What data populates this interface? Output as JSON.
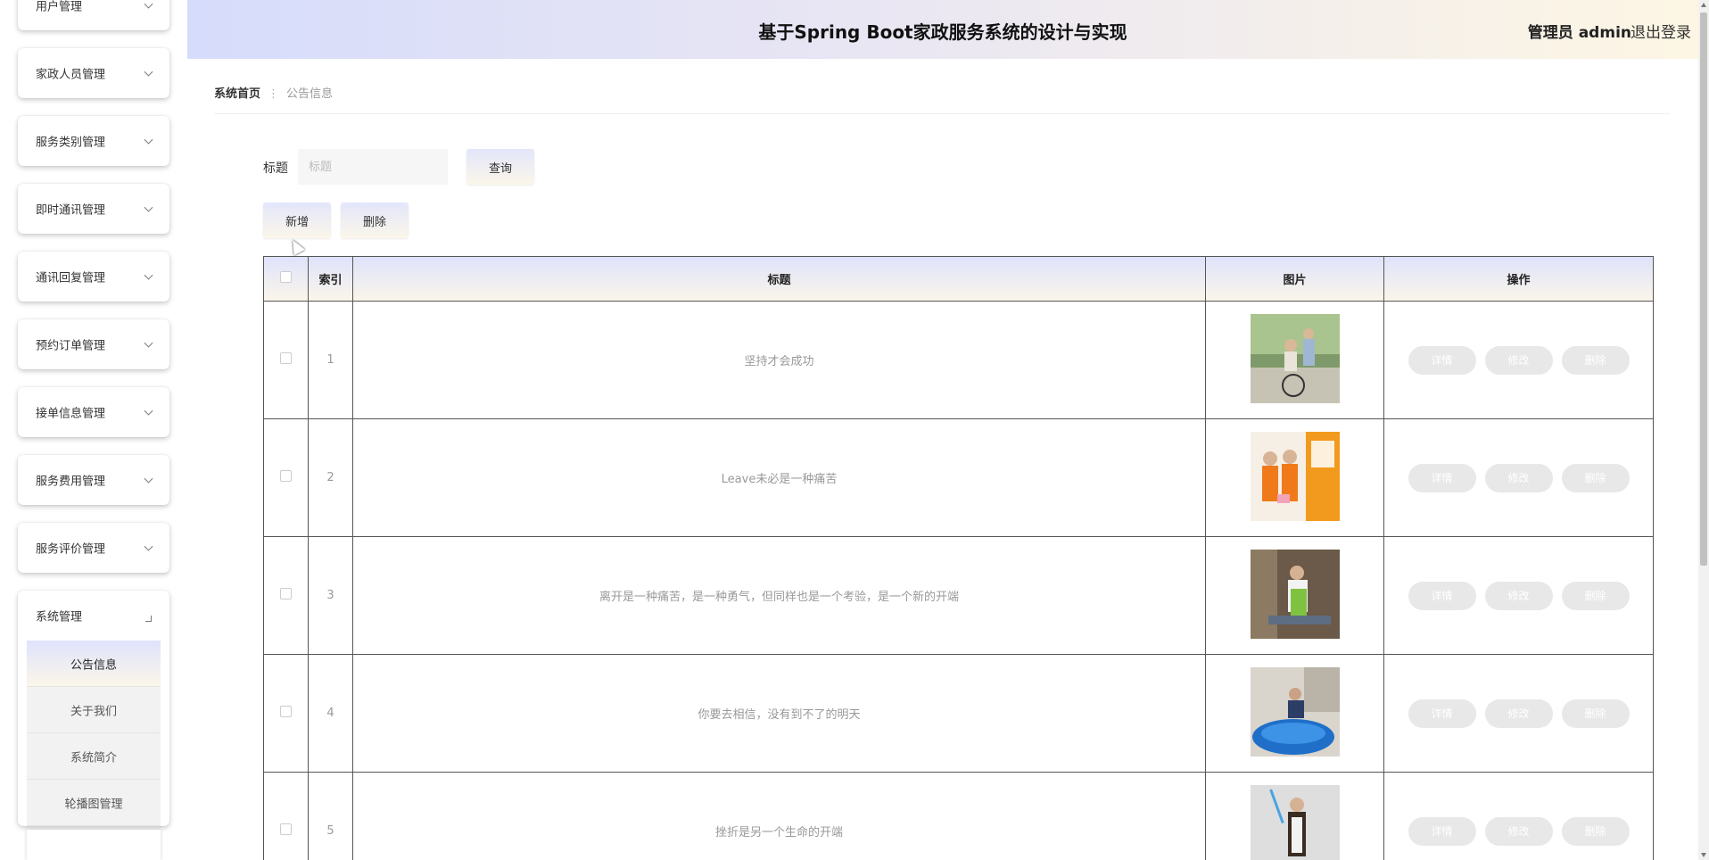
{
  "header": {
    "title": "基于Spring Boot家政服务系统的设计与实现",
    "user": "管理员 admin",
    "logout": "退出登录"
  },
  "sidebar": {
    "items": [
      {
        "label": "用户管理"
      },
      {
        "label": "家政人员管理"
      },
      {
        "label": "服务类别管理"
      },
      {
        "label": "即时通讯管理"
      },
      {
        "label": "通讯回复管理"
      },
      {
        "label": "预约订单管理"
      },
      {
        "label": "接单信息管理"
      },
      {
        "label": "服务费用管理"
      },
      {
        "label": "服务评价管理"
      }
    ],
    "system": {
      "label": "系统管理",
      "subitems": [
        {
          "label": "公告信息"
        },
        {
          "label": "关于我们"
        },
        {
          "label": "系统简介"
        },
        {
          "label": "轮播图管理"
        }
      ]
    }
  },
  "breadcrumb": {
    "home": "系统首页",
    "current": "公告信息"
  },
  "search": {
    "label": "标题",
    "placeholder": "标题",
    "query_label": "查询"
  },
  "toolbar": {
    "add_label": "新增",
    "delete_label": "删除"
  },
  "table": {
    "headers": {
      "index": "索引",
      "title": "标题",
      "image": "图片",
      "actions": "操作"
    },
    "actions": {
      "detail": "详情",
      "edit": "修改",
      "delete": "删除"
    },
    "rows": [
      {
        "index": "1",
        "title": "坚持才会成功"
      },
      {
        "index": "2",
        "title": "Leave未必是一种痛苦"
      },
      {
        "index": "3",
        "title": "离开是一种痛苦，是一种勇气，但同样也是一个考验，是一个新的开端"
      },
      {
        "index": "4",
        "title": "你要去相信，没有到不了的明天"
      },
      {
        "index": "5",
        "title": "挫折是另一个生命的开端"
      }
    ]
  }
}
